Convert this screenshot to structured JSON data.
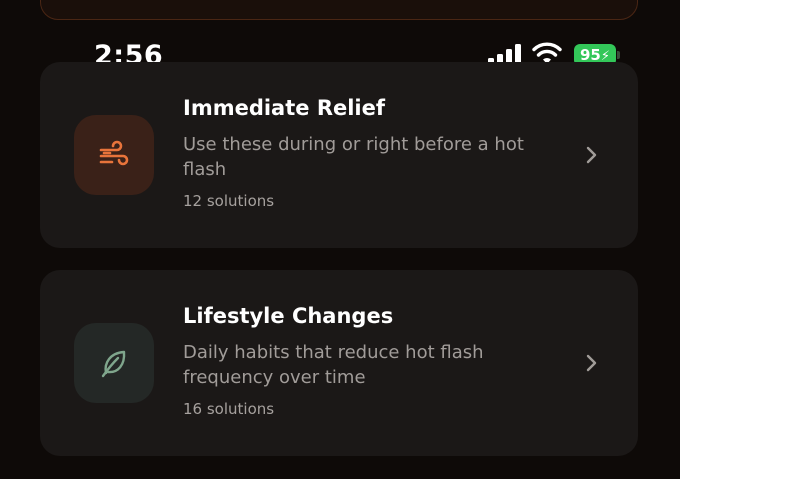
{
  "status_bar": {
    "time": "2:56",
    "battery_level": "95",
    "battery_color": "#33c759"
  },
  "cards": [
    {
      "title": "Immediate Relief",
      "description": "Use these during or right before a hot flash",
      "count": "12 solutions",
      "icon": "wind-icon",
      "accent": "#e8743b"
    },
    {
      "title": "Lifestyle Changes",
      "description": "Daily habits that reduce hot flash frequency over time",
      "count": "16 solutions",
      "icon": "leaf-icon",
      "accent": "#7fa68c"
    }
  ]
}
